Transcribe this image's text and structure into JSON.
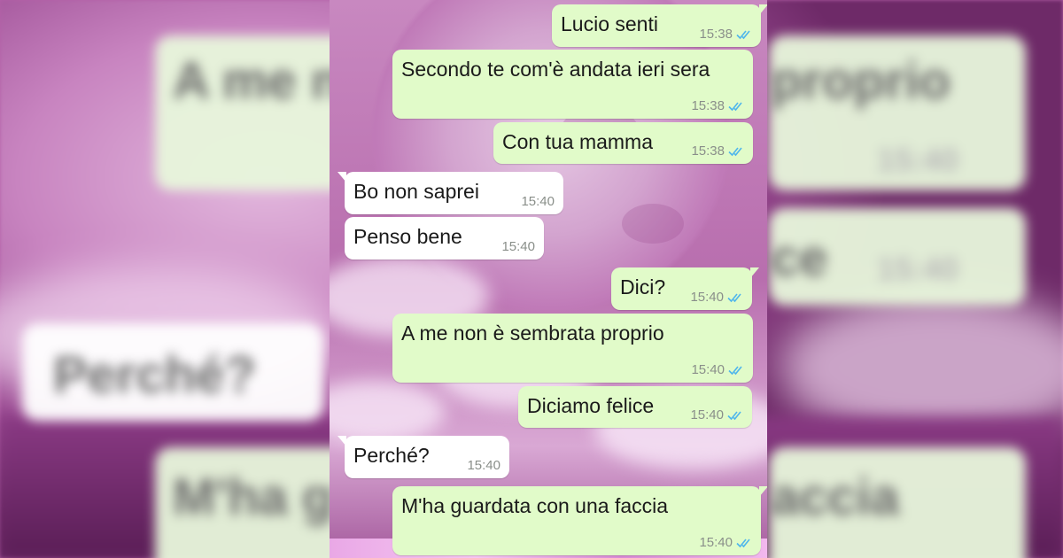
{
  "colors": {
    "outgoing_bubble": "#e1fbc9",
    "incoming_bubble": "#ffffff",
    "read_ticks": "#4fb6ec",
    "timestamp": "#8a8f8a"
  },
  "messages": [
    {
      "direction": "out",
      "text": "Lucio senti",
      "time": "15:38",
      "status": "read-double-check-icon"
    },
    {
      "direction": "out",
      "text": "Secondo te com'è andata ieri sera",
      "time": "15:38",
      "status": "read-double-check-icon"
    },
    {
      "direction": "out",
      "text": "Con tua mamma",
      "time": "15:38",
      "status": "read-double-check-icon"
    },
    {
      "direction": "in",
      "text": "Bo non saprei",
      "time": "15:40"
    },
    {
      "direction": "in",
      "text": "Penso bene",
      "time": "15:40"
    },
    {
      "direction": "out",
      "text": "Dici?",
      "time": "15:40",
      "status": "read-double-check-icon"
    },
    {
      "direction": "out",
      "text": "A me non è sembrata proprio",
      "time": "15:40",
      "status": "read-double-check-icon"
    },
    {
      "direction": "out",
      "text": "Diciamo felice",
      "time": "15:40",
      "status": "read-double-check-icon"
    },
    {
      "direction": "in",
      "text": "Perché?",
      "time": "15:40"
    },
    {
      "direction": "out",
      "text": "M'ha guardata con una faccia",
      "time": "15:40",
      "status": "read-double-check-icon"
    }
  ],
  "backdrop": {
    "blurred_text": [
      "A me n",
      "proprio",
      "15:40",
      "ce",
      "15:40",
      "Perché?",
      "M'ha g",
      "accia"
    ]
  }
}
